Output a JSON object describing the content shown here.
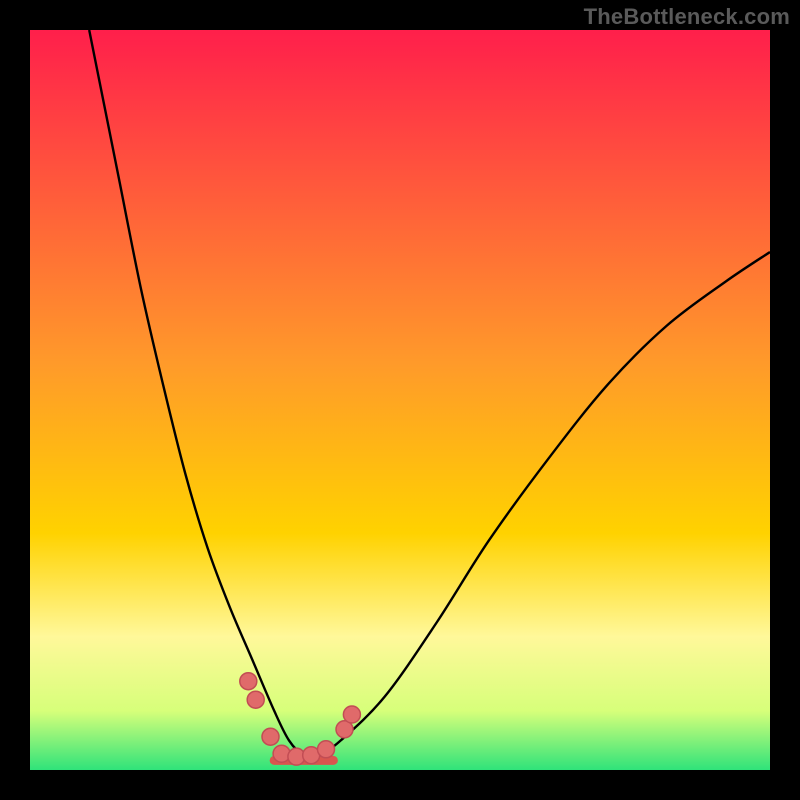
{
  "watermark": "TheBottleneck.com",
  "colors": {
    "frame": "#000000",
    "gradient_top": "#ff1f4b",
    "gradient_mid": "#ffd200",
    "gradient_low": "#fff89a",
    "gradient_green": "#2fe37a",
    "curve": "#000000",
    "marker_fill": "#e06a6a",
    "marker_stroke": "#c24d54",
    "baseline": "#d9564e"
  },
  "chart_data": {
    "type": "line",
    "title": "",
    "xlabel": "",
    "ylabel": "",
    "xlim": [
      0,
      100
    ],
    "ylim": [
      0,
      100
    ],
    "series": [
      {
        "name": "bottleneck-curve",
        "x": [
          8,
          10,
          12,
          15,
          18,
          21,
          24,
          27,
          30,
          33,
          35,
          37,
          39,
          42,
          48,
          55,
          62,
          70,
          78,
          86,
          94,
          100
        ],
        "y": [
          100,
          90,
          80,
          65,
          52,
          40,
          30,
          22,
          15,
          8,
          4,
          2,
          2,
          4,
          10,
          20,
          31,
          42,
          52,
          60,
          66,
          70
        ]
      }
    ],
    "markers": [
      {
        "x": 29.5,
        "y": 12
      },
      {
        "x": 30.5,
        "y": 9.5
      },
      {
        "x": 32.5,
        "y": 4.5
      },
      {
        "x": 34,
        "y": 2.2
      },
      {
        "x": 36,
        "y": 1.8
      },
      {
        "x": 38,
        "y": 2
      },
      {
        "x": 40,
        "y": 2.8
      },
      {
        "x": 42.5,
        "y": 5.5
      },
      {
        "x": 43.5,
        "y": 7.5
      }
    ],
    "baseline_segment": {
      "x1": 33,
      "x2": 41,
      "y": 1.3
    }
  }
}
